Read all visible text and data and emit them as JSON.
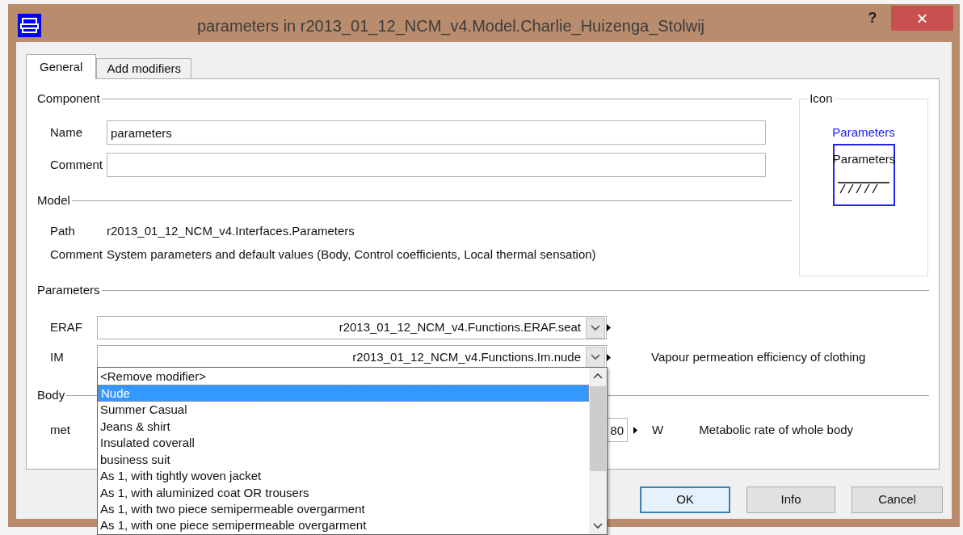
{
  "window": {
    "title": "parameters in r2013_01_12_NCM_v4.Model.Charlie_Huizenga_Stolwij",
    "help": "?",
    "close": "×"
  },
  "tabs": [
    {
      "label": "General",
      "selected": true
    },
    {
      "label": "Add modifiers",
      "selected": false
    }
  ],
  "component": {
    "legend": "Component",
    "fields": [
      {
        "label": "Name",
        "value": "parameters"
      },
      {
        "label": "Comment"
      }
    ]
  },
  "model": {
    "legend": "Model",
    "rows": [
      {
        "label": "Path",
        "value": "r2013_01_12_NCM_v4.Interfaces.Parameters"
      },
      {
        "label": "Comment",
        "value": "System parameters and default values (Body, Control coefficients, Local thermal sensation)"
      }
    ]
  },
  "icon": {
    "legend": "Icon",
    "caption": "Parameters",
    "label": "Parameters"
  },
  "parameters": {
    "legend": "Parameters",
    "rows": [
      {
        "label": "ERAF",
        "value": "r2013_01_12_NCM_v4.Functions.ERAF.seat"
      },
      {
        "label": "IM",
        "value": "r2013_01_12_NCM_v4.Functions.Im.nude",
        "description": "Vapour permeation efficiency of clothing"
      }
    ]
  },
  "body": {
    "legend": "Body",
    "rows": [
      {
        "label": "met",
        "value": "80",
        "unit": "W",
        "description": "Metabolic rate of whole body"
      }
    ]
  },
  "dropdown": {
    "items": [
      {
        "label": "<Remove modifier>",
        "selected": false
      },
      {
        "label": "Nude",
        "selected": true
      },
      {
        "label": "Summer Casual",
        "selected": false
      },
      {
        "label": "Jeans & shirt",
        "selected": false
      },
      {
        "label": "Insulated coverall",
        "selected": false
      },
      {
        "label": "business suit",
        "selected": false
      },
      {
        "label": "As 1, with tightly woven jacket",
        "selected": false
      },
      {
        "label": "As 1, with aluminized coat OR trousers",
        "selected": false
      },
      {
        "label": "As 1, with two piece semipermeable overgarment",
        "selected": false
      },
      {
        "label": "As 1, with one piece semipermeable overgarment",
        "selected": false
      }
    ]
  },
  "buttons": [
    {
      "label": "OK",
      "default": true
    },
    {
      "label": "Info",
      "default": false
    },
    {
      "label": "Cancel",
      "default": false
    }
  ]
}
